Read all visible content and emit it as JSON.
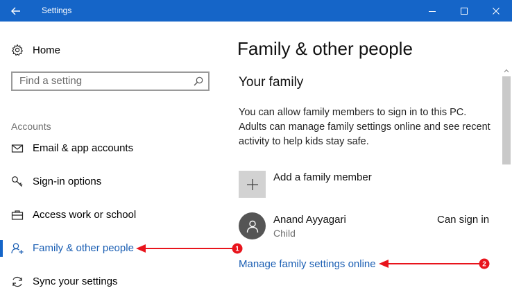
{
  "window": {
    "title": "Settings",
    "colors": {
      "titlebar": "#1565c8",
      "accent": "#1a5eb3",
      "annotation": "#e8141c"
    }
  },
  "sidebar": {
    "home_label": "Home",
    "search_placeholder": "Find a setting",
    "section_label": "Accounts",
    "items": [
      {
        "label": "Email & app accounts",
        "icon": "email-icon"
      },
      {
        "label": "Sign-in options",
        "icon": "key-icon"
      },
      {
        "label": "Access work or school",
        "icon": "briefcase-icon"
      },
      {
        "label": "Family & other people",
        "icon": "add-person-icon",
        "selected": true
      },
      {
        "label": "Sync your settings",
        "icon": "sync-icon"
      }
    ]
  },
  "main": {
    "page_title": "Family & other people",
    "section_title": "Your family",
    "description": "You can allow family members to sign in to this PC. Adults can manage family settings online and see recent activity to help kids stay safe.",
    "add_member_label": "Add a family member",
    "member": {
      "name": "Anand Ayyagari",
      "role": "Child",
      "status": "Can sign in"
    },
    "manage_link": "Manage family settings online"
  },
  "annotations": {
    "badge_1": "1",
    "badge_2": "2"
  }
}
